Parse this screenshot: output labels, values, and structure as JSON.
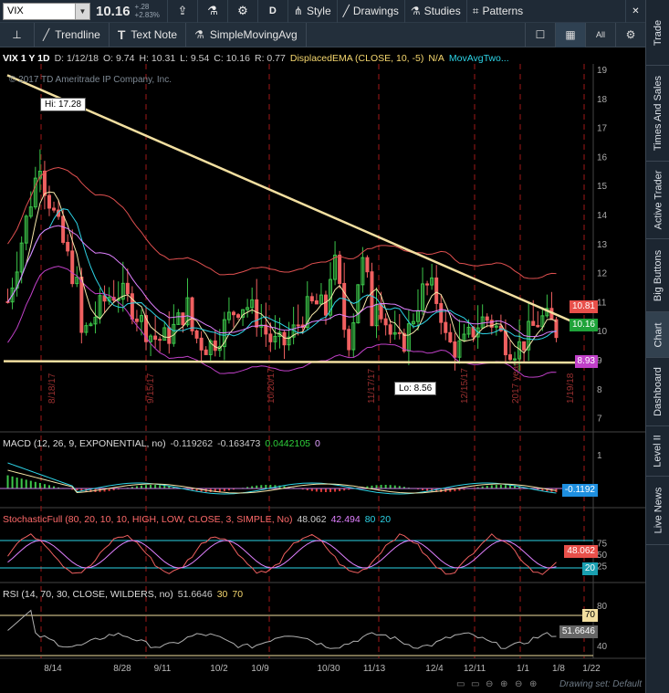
{
  "topbar": {
    "symbol": "VIX",
    "last": "10.16",
    "change_top": "+.28",
    "change_bottom": "+2.83%",
    "period_button": "D",
    "style_label": "Style",
    "drawings_label": "Drawings",
    "studies_label": "Studies",
    "patterns_label": "Patterns"
  },
  "drawbar": {
    "trendline_label": "Trendline",
    "textnote_label": "Text Note",
    "sma_label": "SimpleMovingAvg",
    "all_label": "All"
  },
  "vtabs": [
    "Trade",
    "Times And Sales",
    "Active Trader",
    "Big Buttons",
    "Chart",
    "Dashboard",
    "Level II",
    "Live News"
  ],
  "price_header": {
    "symbol_period": "VIX 1 Y 1D",
    "date": "D: 1/12/18",
    "open": "O: 9.74",
    "high": "H: 10.31",
    "low": "L: 9.54",
    "close": "C: 10.16",
    "range": "R: 0.77",
    "study1": "DisplacedEMA (CLOSE, 10, -5)",
    "study1_value": "N/A",
    "study2": "MovAvgTwo..."
  },
  "copyright": "© 2017 TD Ameritrade IP Company, Inc.",
  "hi_label": "Hi: 17.28",
  "lo_label": "Lo: 8.56",
  "price_badges": {
    "upper": "10.81",
    "last": "10.16",
    "lower": "8.93"
  },
  "colors": {
    "upper_badge": "#e8504a",
    "last_badge": "#1fa33a",
    "lower_badge": "#c040c8",
    "trendline": "#f2dfa0"
  },
  "price_axis": [
    "19",
    "18",
    "17",
    "16",
    "15",
    "14",
    "13",
    "12",
    "11",
    "10",
    "9",
    "8",
    "7"
  ],
  "vertical_date_labels": [
    "8/18/17",
    "9/15/17",
    "10/20/17",
    "11/17/17",
    "12/15/17",
    "2017 year",
    "1/19/18"
  ],
  "macd": {
    "title": "MACD (12, 26, 9, EXPONENTIAL, no)",
    "v1": "-0.119262",
    "v2": "-0.163473",
    "v3": "0.0442105",
    "v4": "0",
    "badge": "-0.1192",
    "axis_top": "1"
  },
  "stoch": {
    "title": "StochasticFull (80, 20, 10, 10, HIGH, LOW, CLOSE, 3, SIMPLE, No)",
    "v1": "48.062",
    "v2": "42.494",
    "v3": "80",
    "v4": "20",
    "axis": [
      "75",
      "50",
      "25"
    ],
    "badge1": "48.062",
    "badge2": "20"
  },
  "rsi": {
    "title": "RSI (14, 70, 30, CLOSE, WILDERS, no)",
    "v1": "51.6646",
    "v2": "30",
    "v3": "70",
    "axis": [
      "80",
      "40"
    ],
    "badge1": "70",
    "badge2": "51.6646"
  },
  "x_axis": [
    "8/14",
    "8/28",
    "9/11",
    "10/2",
    "10/9",
    "10/30",
    "11/13",
    "12/4",
    "12/11",
    "1/1",
    "1/8",
    "1/22"
  ],
  "footer": "Drawing set: Default"
}
